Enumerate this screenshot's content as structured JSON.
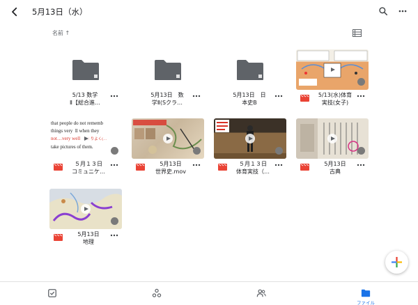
{
  "header": {
    "title": "5月13日（水）",
    "back_icon": "chevron-left-icon",
    "search_icon": "search-icon",
    "more_icon": "more-vert-icon"
  },
  "sort": {
    "label": "名前 ↑",
    "view_icon": "list-view-icon"
  },
  "items": [
    {
      "type": "folder",
      "name_line1": "5/13 数学",
      "name_line2": "Ⅱ【総合進…"
    },
    {
      "type": "folder",
      "name_line1": "5月13日　数",
      "name_line2": "学Ⅱ(Sクラ…"
    },
    {
      "type": "folder",
      "name_line1": "5月13日　日",
      "name_line2": "本史B"
    },
    {
      "type": "video",
      "name_line1": "5/13(水)体育",
      "name_line2": "実技(女子)"
    },
    {
      "type": "video",
      "name_line1": "５月１３日",
      "name_line2": "コミュニケ…"
    },
    {
      "type": "video",
      "name_line1": "5月13日",
      "name_line2": "世界史.mov"
    },
    {
      "type": "video",
      "name_line1": "５月１３日",
      "name_line2": "体育実技（…"
    },
    {
      "type": "video",
      "name_line1": "5月13日",
      "name_line2": "古典"
    },
    {
      "type": "video",
      "name_line1": "5月13日",
      "name_line2": "地理"
    }
  ],
  "thumb_text": {
    "line1": "that people do not rememb",
    "line2": "things very",
    "line2b": "ll when they",
    "line3": "not…very well",
    "line3b": "あまりよく(…",
    "line4": "take pictures of them."
  },
  "bottom_nav": [
    {
      "icon": "checkbox-icon",
      "label": ""
    },
    {
      "icon": "shared-nodes-icon",
      "label": ""
    },
    {
      "icon": "people-icon",
      "label": ""
    },
    {
      "icon": "folder-icon",
      "label": "ファイル"
    }
  ],
  "fab": {
    "icon": "plus-icon"
  },
  "colors": {
    "accent": "#1a73e8",
    "folder": "#5f6368",
    "video_red": "#ea4335"
  }
}
